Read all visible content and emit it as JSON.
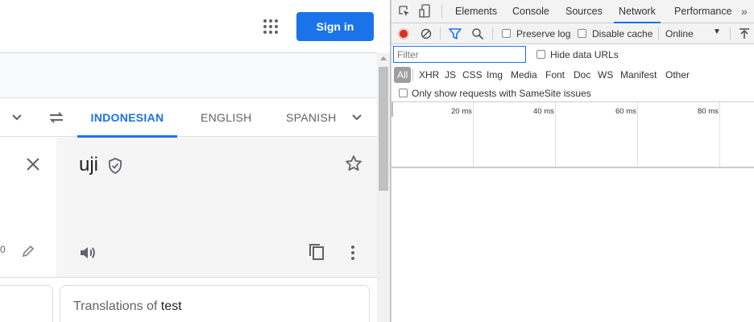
{
  "translate": {
    "header": {
      "signin_label": "Sign in"
    },
    "languages": {
      "tabs": [
        "INDONESIAN",
        "ENGLISH",
        "SPANISH"
      ]
    },
    "source": {
      "char_count": "0"
    },
    "target": {
      "text": "uji"
    },
    "translations_card": {
      "prefix": "Translations of ",
      "word": "test"
    },
    "colors": {
      "accent": "#1a73e8",
      "target_panel": "#f5f5f5"
    }
  },
  "devtools": {
    "tabs": [
      "Elements",
      "Console",
      "Sources",
      "Network",
      "Performance"
    ],
    "active_tab": "Network",
    "more_tabs": "»",
    "toolbar": {
      "preserve_log": "Preserve log",
      "disable_cache": "Disable cache",
      "throttling": "Online",
      "throttle_arrow": "▼"
    },
    "filter": {
      "placeholder": "Filter",
      "hide_data_urls": "Hide data URLs"
    },
    "types": [
      "All",
      "XHR",
      "JS",
      "CSS",
      "Img",
      "Media",
      "Font",
      "Doc",
      "WS",
      "Manifest",
      "Other"
    ],
    "samesite": "Only show requests with SameSite issues",
    "timeline": {
      "ticks": [
        "20 ms",
        "40 ms",
        "60 ms",
        "80 ms"
      ]
    },
    "colors": {
      "record": "#d93025",
      "active_tab_underline": "#1a73e8"
    }
  }
}
